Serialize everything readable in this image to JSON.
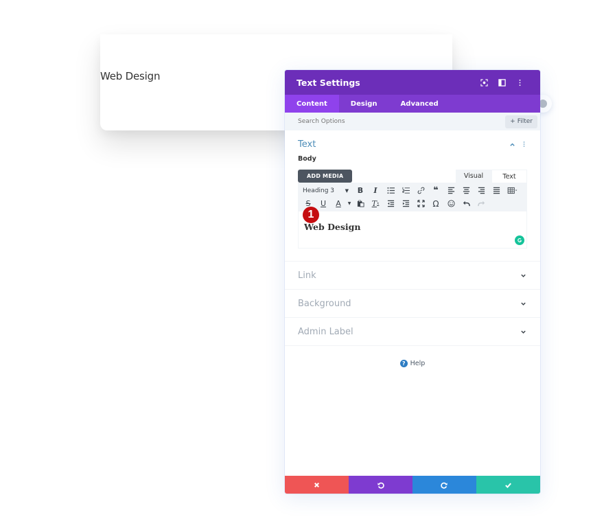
{
  "canvas": {
    "module_text": "Web Design"
  },
  "panel": {
    "title": "Text Settings",
    "header_icons": [
      "focus-icon",
      "split-view-icon",
      "more-options-icon"
    ],
    "tabs": [
      {
        "label": "Content",
        "active": true
      },
      {
        "label": "Design",
        "active": false
      },
      {
        "label": "Advanced",
        "active": false
      }
    ],
    "search": {
      "placeholder": "Search Options",
      "value": ""
    },
    "filter_label": "Filter",
    "sections": {
      "text": {
        "title": "Text",
        "body_label": "Body",
        "add_media": "ADD MEDIA",
        "mode_tabs": {
          "visual": "Visual",
          "text": "Text"
        },
        "format_select": "Heading 3",
        "toolbar_row1": [
          "bold",
          "italic",
          "bullet-list",
          "numbered-list",
          "link",
          "blockquote",
          "align-left",
          "align-center",
          "align-right",
          "align-justify",
          "table"
        ],
        "toolbar_row2": [
          "strikethrough",
          "underline",
          "text-color",
          "paste-as-text",
          "clear-formatting",
          "outdent",
          "indent",
          "fullscreen",
          "special-character",
          "emoji",
          "undo",
          "redo"
        ],
        "editor_content": "Web Design",
        "step_badge": "1"
      },
      "collapsed": [
        {
          "title": "Link"
        },
        {
          "title": "Background"
        },
        {
          "title": "Admin Label"
        }
      ]
    },
    "help_label": "Help",
    "footer": {
      "buttons": [
        {
          "name": "discard",
          "color": "#ef5555"
        },
        {
          "name": "undo",
          "color": "#7e3bd0"
        },
        {
          "name": "redo",
          "color": "#2b87da"
        },
        {
          "name": "save",
          "color": "#29c4a9"
        }
      ]
    }
  },
  "colors": {
    "header": "#6c2eb9",
    "tabs": "#7e3bd0",
    "active_tab": "#8f42ec",
    "section_open_title": "#4d8db8",
    "badge": "#c50d10"
  }
}
